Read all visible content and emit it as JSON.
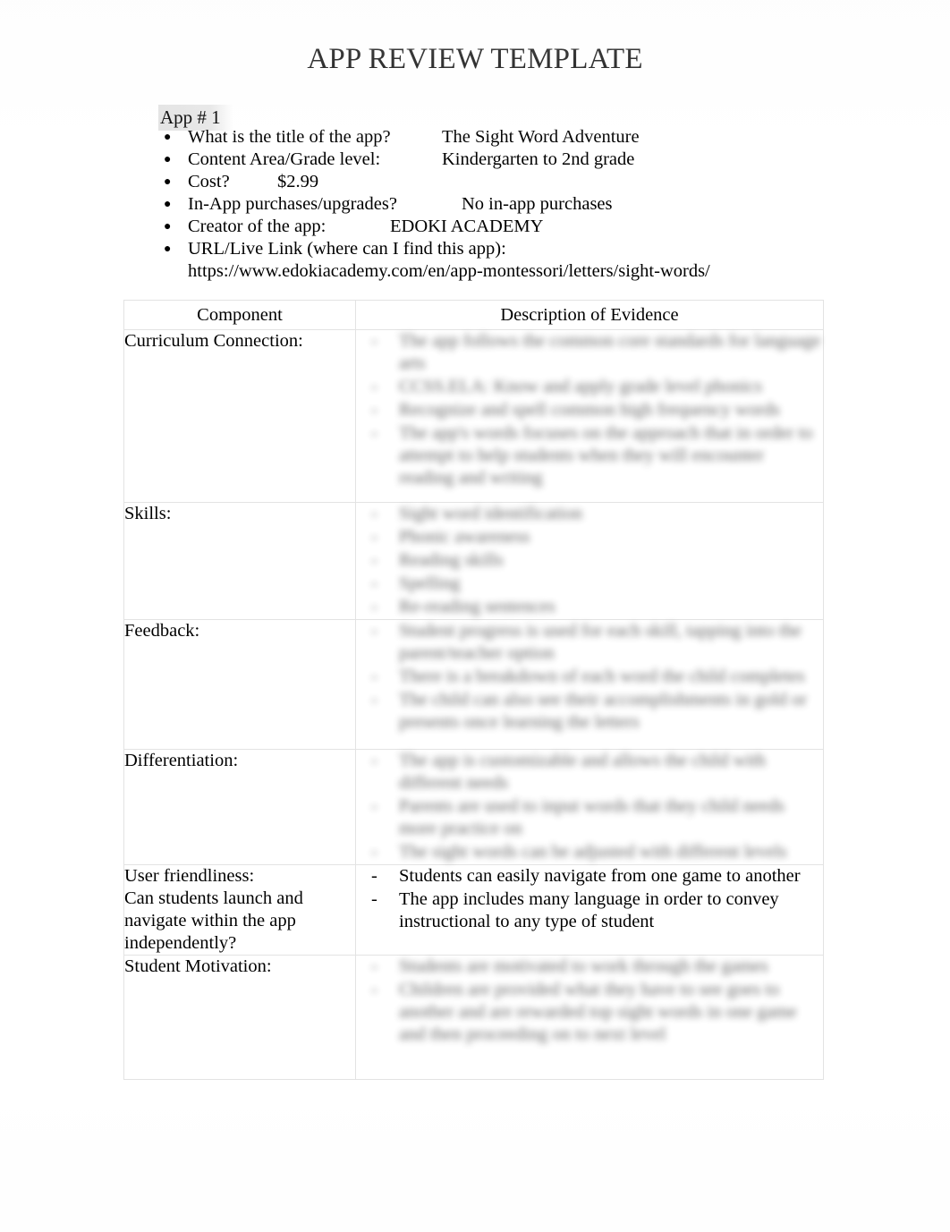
{
  "document": {
    "title": "APP REVIEW TEMPLATE",
    "app_heading": "App # 1"
  },
  "facts": [
    {
      "label": "What is the title of the app?",
      "value": "The Sight Word Adventure",
      "tab": "tab-a"
    },
    {
      "label": "Content Area/Grade level:",
      "value": "Kindergarten to 2nd grade",
      "tab": "tab-a"
    },
    {
      "label": "Cost?",
      "value": "$2.99",
      "tab": "tab-b"
    },
    {
      "label": "In-App purchases/upgrades?",
      "value": "No in-app purchases",
      "tab": "tab-c"
    },
    {
      "label": "Creator of the app:",
      "value": "EDOKI ACADEMY",
      "tab": "tab-d"
    }
  ],
  "url_item": {
    "label": "URL/Live Link (where can I find this app):",
    "url": "https://www.edokiacademy.com/en/app-montessori/letters/sight-words/"
  },
  "table": {
    "headers": {
      "component": "Component",
      "evidence": "Description of Evidence"
    },
    "rows": [
      {
        "label": "Curriculum Connection:",
        "label_extra": "",
        "legible": false,
        "items": [
          "The app follows the common core standards for language arts",
          "CCSS.ELA: Know and apply grade level phonics",
          "Recognize and spell common high frequency words",
          "The app's words focuses on the approach that in order to attempt to help students when they will encounter reading and writing"
        ]
      },
      {
        "label": "Skills:",
        "label_extra": "",
        "legible": false,
        "items": [
          "Sight word identification",
          "Phonic awareness",
          "Reading skills",
          "Spelling",
          "Re-reading sentences"
        ]
      },
      {
        "label": "Feedback:",
        "label_extra": "",
        "legible": false,
        "items": [
          "Student progress is used for each skill, tapping into the parent/teacher option",
          "There is a breakdown of each word the child completes",
          "The child can also see their accomplishments in gold or presents once learning the letters"
        ]
      },
      {
        "label": "Differentiation:",
        "label_extra": "",
        "legible": false,
        "items": [
          "The app is customizable and allows the child with different needs",
          "Parents are used to input words that they child needs more practice on",
          "The sight words can be adjusted with different levels"
        ]
      },
      {
        "label": "User friendliness:",
        "label_extra": "Can students launch and navigate within the app independently?",
        "legible": true,
        "items": [
          "Students can easily navigate from one game to another",
          "The app includes many language in order to convey instructional to any type of student"
        ]
      },
      {
        "label": "Student Motivation:",
        "label_extra": "",
        "legible": false,
        "items": [
          "Students are motivated to work through the games",
          "Children are provided what they have to see goes to another and are rewarded top sight words in one game and then proceeding on to next level"
        ]
      }
    ]
  }
}
